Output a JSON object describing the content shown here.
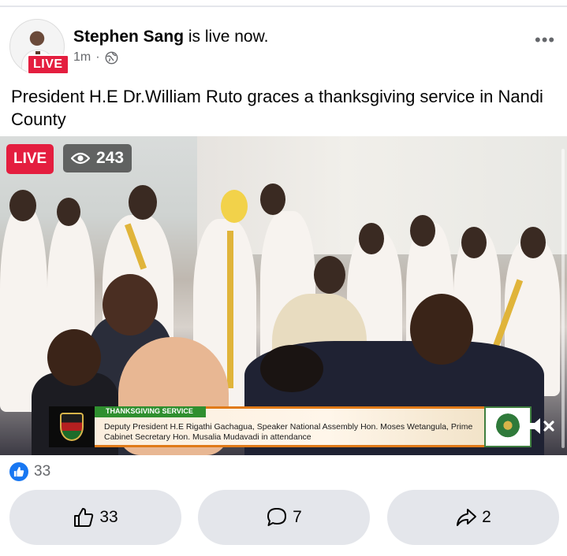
{
  "post": {
    "author": "Stephen Sang",
    "status_text": "is live now.",
    "avatar_badge": "LIVE",
    "time": "1m",
    "dot": "·",
    "more_label": "•••",
    "caption": "President H.E Dr.William Ruto graces a thanksgiving service in Nandi County"
  },
  "video": {
    "live_label": "LIVE",
    "viewer_count": "243",
    "lower_third": {
      "tag": "THANKSGIVING SERVICE",
      "text": "Deputy President H.E Rigathi Gachagua, Speaker National Assembly Hon. Moses Wetangula, Prime Cabinet Secretary Hon. Musalia Mudavadi in attendance"
    }
  },
  "engagement": {
    "like_count": "33"
  },
  "actions": {
    "like_count": "33",
    "comment_count": "7",
    "share_count": "2"
  },
  "colors": {
    "live_red": "#e41e3f",
    "facebook_blue": "#1877f2",
    "button_gray": "#e4e6eb"
  }
}
